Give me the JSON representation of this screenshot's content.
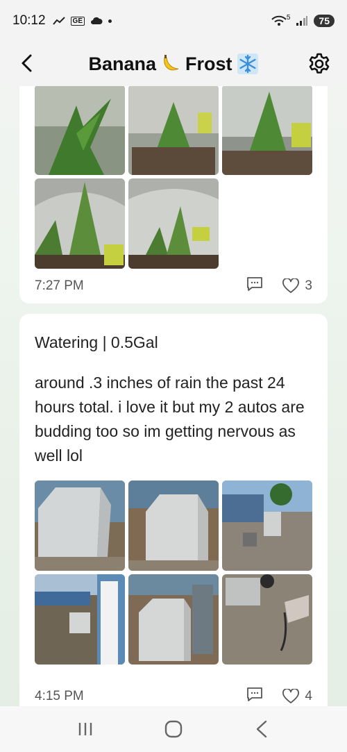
{
  "status": {
    "time": "10:12",
    "battery": "75",
    "net": "5"
  },
  "header": {
    "title_part1": "Banana",
    "title_part2": "Frost"
  },
  "posts": [
    {
      "time": "7:27 PM",
      "likes": "3"
    },
    {
      "title": "Watering | 0.5Gal",
      "body": "around .3 inches of rain the past 24 hours total. i love it but my 2 autos are budding too so im getting nervous as well lol",
      "time": "4:15 PM",
      "likes": "4"
    }
  ],
  "icons": [
    "back-icon",
    "banana-icon",
    "snowflake-icon",
    "gear-icon",
    "comment-icon",
    "heart-icon",
    "recents-icon",
    "home-icon",
    "nav-back-icon"
  ]
}
